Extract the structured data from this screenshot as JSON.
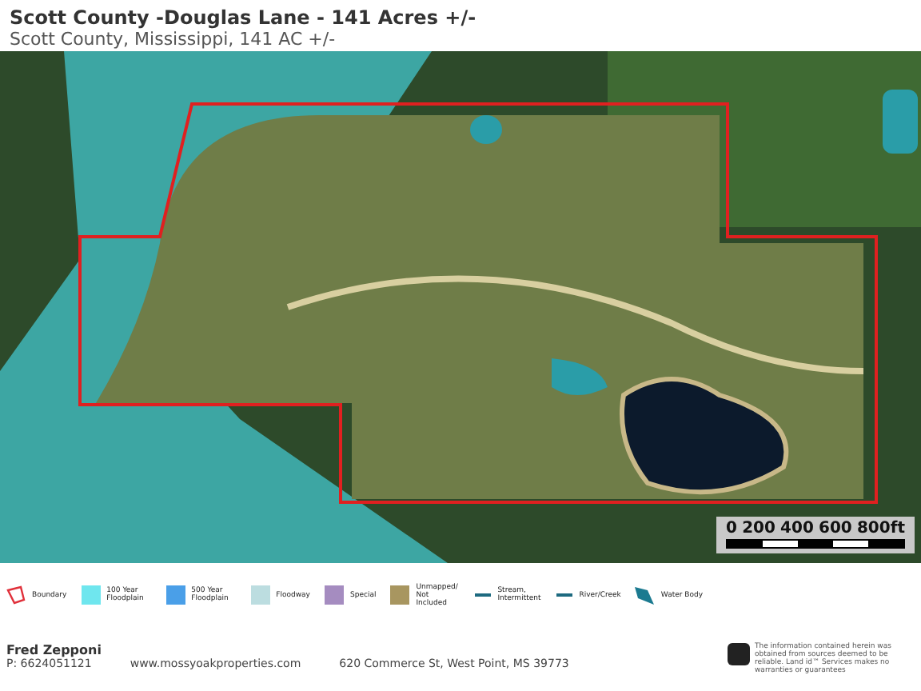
{
  "header": {
    "title": "Scott County -Douglas Lane - 141 Acres +/-",
    "subtitle": "Scott County, Mississippi, 141 AC +/-"
  },
  "scale_bar": {
    "ticks": [
      "0",
      "200",
      "400",
      "600",
      "800ft"
    ]
  },
  "legend": [
    {
      "kind": "outline",
      "label": "Boundary",
      "color": "#e0303a"
    },
    {
      "kind": "fill",
      "label": "100 Year Floodplain",
      "color": "#6fe6ee"
    },
    {
      "kind": "fill",
      "label": "500 Year Floodplain",
      "color": "#4a9fe8"
    },
    {
      "kind": "fill",
      "label": "Floodway",
      "color": "#bcdde0"
    },
    {
      "kind": "fill",
      "label": "Special",
      "color": "#a58cc0"
    },
    {
      "kind": "fill",
      "label": "Unmapped/ Not Included",
      "color": "#a89660"
    },
    {
      "kind": "dashed",
      "label": "Stream, Intermittent",
      "color": "#1d6a80"
    },
    {
      "kind": "line",
      "label": "River/Creek",
      "color": "#1d6a80"
    },
    {
      "kind": "water",
      "label": "Water Body",
      "color": "#1b7a90"
    }
  ],
  "footer": {
    "agent": "Fred Zepponi",
    "phone": "P: 6624051121",
    "website": "www.mossyoakproperties.com",
    "address": "620 Commerce St, West Point, MS 39773",
    "disclaimer": "The information contained herein was obtained from sources deemed to be reliable. Land id™ Services makes no warranties or guarantees"
  }
}
